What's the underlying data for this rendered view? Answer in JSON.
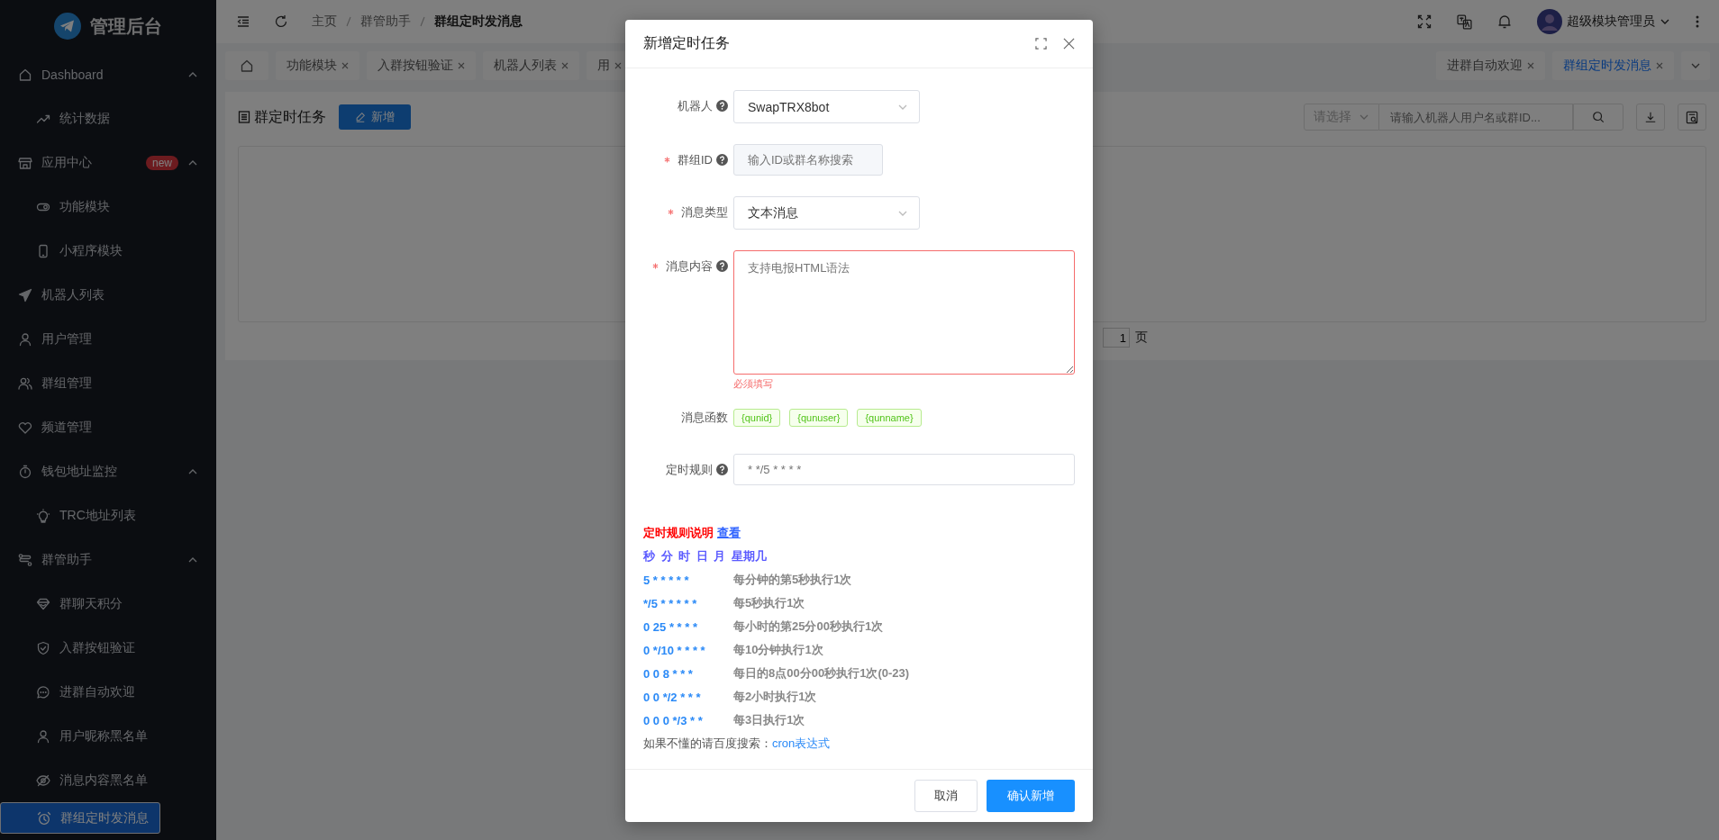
{
  "sidebar": {
    "title": "管理后台",
    "items": [
      {
        "label": "Dashboard",
        "selected": false,
        "expanded": true,
        "children": [
          {
            "label": "统计数据",
            "selected": false
          }
        ]
      },
      {
        "label": "应用中心",
        "badge": "new",
        "selected": false,
        "expanded": true,
        "children": [
          {
            "label": "功能模块",
            "selected": false
          },
          {
            "label": "小程序模块",
            "selected": false
          }
        ]
      },
      {
        "label": "机器人列表",
        "selected": false
      },
      {
        "label": "用户管理",
        "selected": false
      },
      {
        "label": "群组管理",
        "selected": false
      },
      {
        "label": "频道管理",
        "selected": false
      },
      {
        "label": "钱包地址监控",
        "selected": false,
        "expanded": true,
        "children": [
          {
            "label": "TRC地址列表",
            "selected": false
          }
        ]
      },
      {
        "label": "群管助手",
        "selected": false,
        "expanded": true,
        "children": [
          {
            "label": "群聊天积分",
            "selected": false
          },
          {
            "label": "入群按钮验证",
            "selected": false
          },
          {
            "label": "进群自动欢迎",
            "selected": false
          },
          {
            "label": "用户昵称黑名单",
            "selected": false
          },
          {
            "label": "消息内容黑名单",
            "selected": false
          },
          {
            "label": "群组定时发消息",
            "selected": true
          }
        ]
      }
    ]
  },
  "header": {
    "breadcrumb": [
      "主页",
      "群管助手",
      "群组定时发消息"
    ],
    "user": "超级模块管理员"
  },
  "tabs": {
    "left": [
      {
        "label": "功能模块",
        "selected": false
      },
      {
        "label": "入群按钮验证",
        "selected": false
      },
      {
        "label": "机器人列表",
        "selected": false
      },
      {
        "label": "用",
        "selected": false
      }
    ],
    "right": [
      {
        "label": "进群自动欢迎",
        "selected": false
      },
      {
        "label": "群组定时发消息",
        "selected": true
      }
    ]
  },
  "content": {
    "title": "群定时任务",
    "add_button": "新增",
    "filter_select": {
      "placeholder": "请选择"
    },
    "search": {
      "placeholder": "请输入机器人用户名或群ID..."
    },
    "pagination": {
      "page": "1",
      "suffix": "页"
    }
  },
  "modal": {
    "title": "新增定时任务",
    "fields": [
      {
        "kind": "select",
        "label": "机器人",
        "required": false,
        "help": true,
        "value": "SwapTRX8bot"
      },
      {
        "kind": "input",
        "label": "群组ID",
        "required": true,
        "help": true,
        "disabled": true,
        "placeholder": "输入ID或群名称搜索"
      },
      {
        "kind": "select",
        "label": "消息类型",
        "required": true,
        "help": false,
        "value": "文本消息"
      },
      {
        "kind": "textarea",
        "label": "消息内容",
        "required": true,
        "help": true,
        "placeholder": "支持电报HTML语法",
        "error": "必须填写"
      },
      {
        "kind": "tags",
        "label": "消息函数",
        "required": false,
        "help": false,
        "tags": [
          "{qunid}",
          "{qunuser}",
          "{qunname}"
        ]
      },
      {
        "kind": "input",
        "label": "定时规则",
        "required": false,
        "help": true,
        "disabled": false,
        "placeholder": "* */5 * * * *"
      }
    ],
    "rules": {
      "title": "定时规则说明",
      "link": "查看",
      "columns": "秒 分 时 日 月 星期几",
      "rows": [
        {
          "expr": "5 * * * * *",
          "desc": "每分钟的第5秒执行1次"
        },
        {
          "expr": "*/5 * * * * *",
          "desc": "每5秒执行1次"
        },
        {
          "expr": "0 25 * * * *",
          "desc": "每小时的第25分00秒执行1次"
        },
        {
          "expr": "0 */10 * * * *",
          "desc": "每10分钟执行1次"
        },
        {
          "expr": "0 0 8 * * *",
          "desc": "每日的8点00分00秒执行1次(0-23)"
        },
        {
          "expr": "0 0 */2 * * *",
          "desc": "每2小时执行1次"
        },
        {
          "expr": "0 0 0 */3 * *",
          "desc": "每3日执行1次"
        }
      ],
      "note": "如果不懂的请百度搜索：",
      "note_link": "cron表达式"
    },
    "cancel": "取消",
    "confirm": "确认新增"
  }
}
